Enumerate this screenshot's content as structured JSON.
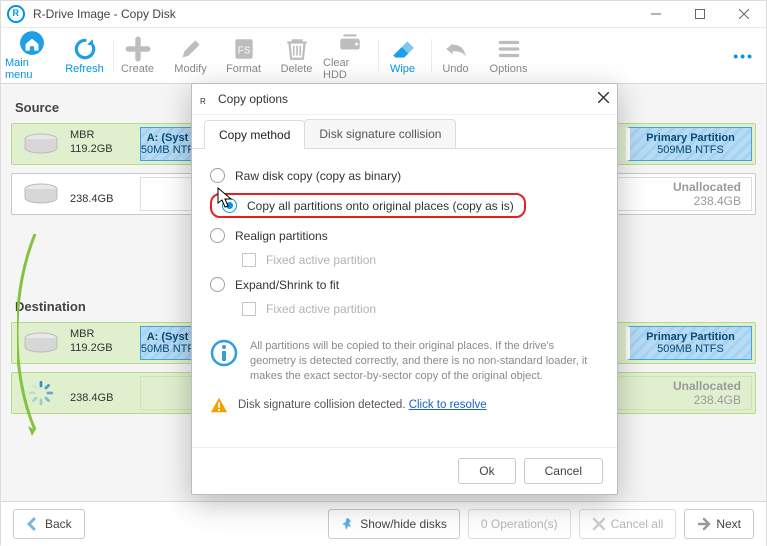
{
  "window": {
    "title": "R-Drive Image - Copy Disk"
  },
  "toolbar": {
    "main_menu": "Main menu",
    "refresh": "Refresh",
    "create": "Create",
    "modify": "Modify",
    "format": "Format",
    "delete": "Delete",
    "clear_hdd": "Clear HDD",
    "wipe": "Wipe",
    "undo": "Undo",
    "options": "Options"
  },
  "sections": {
    "source": "Source",
    "destination": "Destination"
  },
  "disks": {
    "src1": {
      "scheme": "MBR",
      "size": "119.2GB",
      "sys": {
        "label": "A: (Syst",
        "sub": "50MB NTF"
      },
      "primary": {
        "label": "Primary Partition",
        "sub": "509MB NTFS"
      }
    },
    "src2": {
      "size": "238.4GB",
      "unalloc": {
        "label": "Unallocated",
        "sub": "238.4GB"
      }
    },
    "dst1": {
      "scheme": "MBR",
      "size": "119.2GB",
      "sys": {
        "label": "A: (Syst",
        "sub": "50MB NTF"
      },
      "primary": {
        "label": "Primary Partition",
        "sub": "509MB NTFS"
      }
    },
    "dst2": {
      "size": "238.4GB",
      "unalloc": {
        "label": "Unallocated",
        "sub": "238.4GB"
      }
    }
  },
  "bottom": {
    "back": "Back",
    "show_hide": "Show/hide disks",
    "operations": "0 Operation(s)",
    "cancel_all": "Cancel all",
    "next": "Next"
  },
  "modal": {
    "title": "Copy options",
    "tabs": {
      "method": "Copy method",
      "collision": "Disk signature collision"
    },
    "opts": {
      "raw": "Raw disk copy (copy as binary)",
      "copy_all": "Copy all partitions onto original places (copy as is)",
      "realign": "Realign partitions",
      "fixed": "Fixed active partition",
      "expand": "Expand/Shrink to fit"
    },
    "info": "All partitions will be copied to their original places. If the drive's geometry is detected correctly, and there is no non-standard loader, it makes the exact sector-by-sector copy of the original object.",
    "warn": "Disk signature collision detected.",
    "warn_link": "Click to resolve",
    "ok": "Ok",
    "cancel": "Cancel"
  }
}
